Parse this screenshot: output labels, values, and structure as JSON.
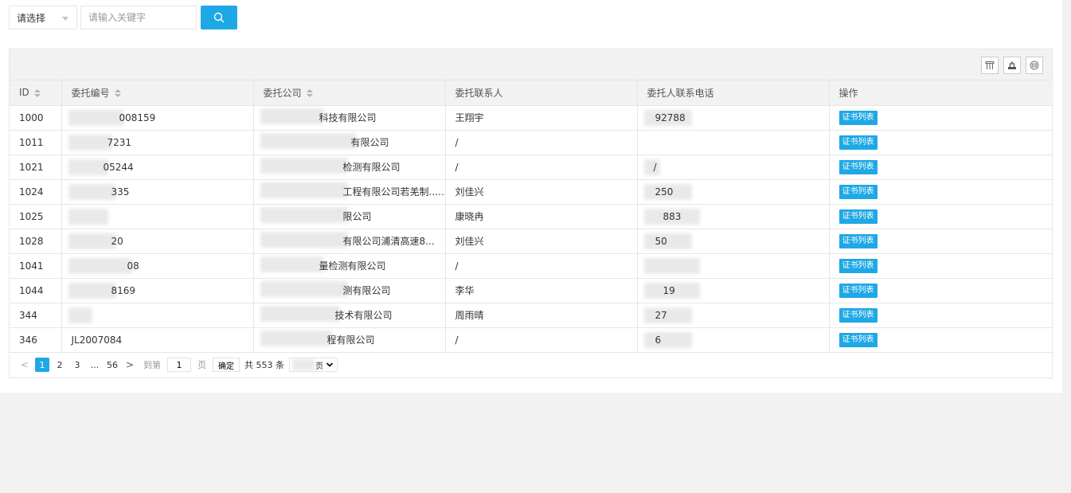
{
  "search": {
    "select_label": "请选择",
    "keyword_placeholder": "请输入关键字"
  },
  "table": {
    "columns": [
      "ID",
      "委托编号",
      "委托公司",
      "委托联系人",
      "委托人联系电话",
      "操作"
    ],
    "action_label": "证书列表",
    "rows": [
      {
        "id": "1000",
        "code": "008159",
        "company": "科技有限公司",
        "contact": "王翔宇",
        "phone": "92788"
      },
      {
        "id": "1011",
        "code": "7231",
        "company": "有限公司",
        "contact": "/",
        "phone": ""
      },
      {
        "id": "1021",
        "code": "05244",
        "company": "检测有限公司",
        "contact": "/",
        "phone": "/"
      },
      {
        "id": "1024",
        "code": "335",
        "company": "工程有限公司若羌制...",
        "contact": "刘佳兴",
        "phone": "250"
      },
      {
        "id": "1025",
        "code": "",
        "company": "限公司",
        "contact": "康晓冉",
        "phone": "883"
      },
      {
        "id": "1028",
        "code": "20",
        "company": "有限公司浦清高速8...",
        "contact": "刘佳兴",
        "phone": "50"
      },
      {
        "id": "1041",
        "code": "08",
        "company": "量检测有限公司",
        "contact": "/",
        "phone": ""
      },
      {
        "id": "1044",
        "code": "8169",
        "company": "测有限公司",
        "contact": "李华",
        "phone": "19"
      },
      {
        "id": "344",
        "code": "",
        "company": "技术有限公司",
        "contact": "周雨晴",
        "phone": "27"
      },
      {
        "id": "346",
        "code": "JL2007084",
        "company": "程有限公司",
        "contact": "/",
        "phone": "6"
      }
    ]
  },
  "pager": {
    "prev": "<",
    "pages": [
      "1",
      "2",
      "3"
    ],
    "ellipsis": "...",
    "last": "56",
    "next": ">",
    "goto_label": "到第",
    "goto_value": "1",
    "page_unit": "页",
    "confirm": "确定",
    "total": "共 553 条",
    "per_page_suffix": "页"
  }
}
